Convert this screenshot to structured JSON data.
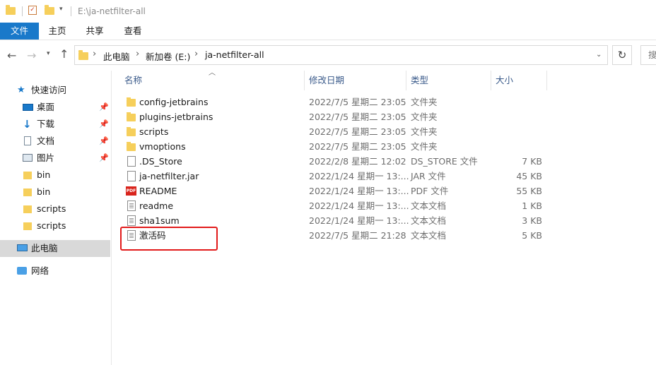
{
  "window": {
    "title": "E:\\ja-netfilter-all"
  },
  "ribbon": {
    "tabs": [
      "文件",
      "主页",
      "共享",
      "查看"
    ]
  },
  "address": {
    "crumbs": [
      "此电脑",
      "新加卷 (E:)",
      "ja-netfilter-all"
    ],
    "search_placeholder": "搜"
  },
  "nav_pane": {
    "items": [
      {
        "label": "快速访问",
        "icon": "star-icon",
        "pinned": false
      },
      {
        "label": "桌面",
        "icon": "desktop-icon",
        "pinned": true
      },
      {
        "label": "下载",
        "icon": "download-icon",
        "pinned": true
      },
      {
        "label": "文档",
        "icon": "document-icon",
        "pinned": true
      },
      {
        "label": "图片",
        "icon": "picture-icon",
        "pinned": true
      },
      {
        "label": "bin",
        "icon": "folder-icon",
        "pinned": false
      },
      {
        "label": "bin",
        "icon": "folder-icon",
        "pinned": false
      },
      {
        "label": "scripts",
        "icon": "folder-icon",
        "pinned": false
      },
      {
        "label": "scripts",
        "icon": "folder-icon",
        "pinned": false
      },
      {
        "label": "此电脑",
        "icon": "computer-icon",
        "pinned": false,
        "selected": true
      },
      {
        "label": "网络",
        "icon": "network-icon",
        "pinned": false
      }
    ]
  },
  "columns": {
    "name": "名称",
    "date": "修改日期",
    "type": "类型",
    "size": "大小"
  },
  "files": [
    {
      "name": "config-jetbrains",
      "date": "2022/7/5 星期二 23:05",
      "type": "文件夹",
      "size": "",
      "icon": "folder-icon"
    },
    {
      "name": "plugins-jetbrains",
      "date": "2022/7/5 星期二 23:05",
      "type": "文件夹",
      "size": "",
      "icon": "folder-icon"
    },
    {
      "name": "scripts",
      "date": "2022/7/5 星期二 23:05",
      "type": "文件夹",
      "size": "",
      "icon": "folder-icon"
    },
    {
      "name": "vmoptions",
      "date": "2022/7/5 星期二 23:05",
      "type": "文件夹",
      "size": "",
      "icon": "folder-icon"
    },
    {
      "name": ".DS_Store",
      "date": "2022/2/8 星期二 12:02",
      "type": "DS_STORE 文件",
      "size": "7 KB",
      "icon": "file-icon"
    },
    {
      "name": "ja-netfilter.jar",
      "date": "2022/1/24 星期一 13:...",
      "type": "JAR 文件",
      "size": "45 KB",
      "icon": "file-icon"
    },
    {
      "name": "README",
      "date": "2022/1/24 星期一 13:...",
      "type": "PDF 文件",
      "size": "55 KB",
      "icon": "pdf-icon"
    },
    {
      "name": "readme",
      "date": "2022/1/24 星期一 13:...",
      "type": "文本文档",
      "size": "1 KB",
      "icon": "text-file-icon"
    },
    {
      "name": "sha1sum",
      "date": "2022/1/24 星期一 13:...",
      "type": "文本文档",
      "size": "3 KB",
      "icon": "text-file-icon"
    },
    {
      "name": "激活码",
      "date": "2022/7/5 星期二 21:28",
      "type": "文本文档",
      "size": "5 KB",
      "icon": "text-file-icon"
    }
  ],
  "colors": {
    "accent": "#1979ca",
    "highlight": "#e21a1a",
    "folder": "#f6cf5b"
  }
}
